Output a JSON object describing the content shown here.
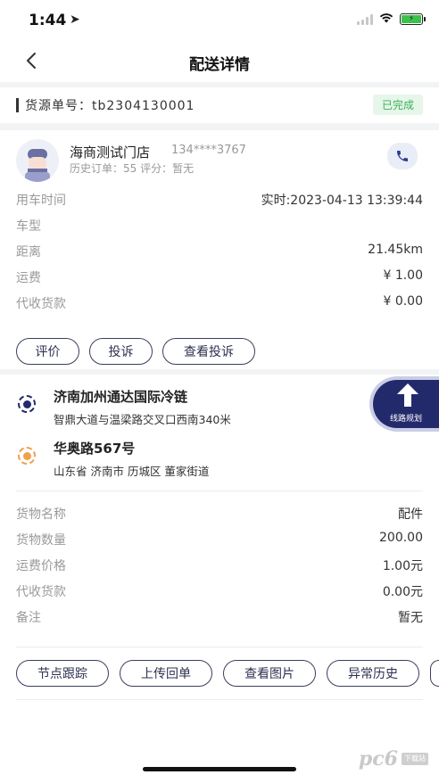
{
  "status_bar": {
    "time": "1:44"
  },
  "header": {
    "title": "配送详情"
  },
  "order": {
    "label": "货源单号：tb2304130001",
    "status": "已完成"
  },
  "shop": {
    "name": "海商测试门店",
    "phone": "134****3767",
    "history": "历史订单：55  评分：暂无",
    "rows": [
      {
        "key": "用车时间",
        "value": "实时:2023-04-13 13:39:44"
      },
      {
        "key": "车型",
        "value": ""
      },
      {
        "key": "距离",
        "value": "21.45km"
      },
      {
        "key": "运费",
        "value": "¥ 1.00"
      },
      {
        "key": "代收货款",
        "value": "¥ 0.00"
      }
    ],
    "actions": [
      "评价",
      "投诉",
      "查看投诉"
    ]
  },
  "route": {
    "start": {
      "title": "济南加州通达国际冷链",
      "address": "智鼎大道与温梁路交叉口西南340米"
    },
    "end": {
      "title": "华奥路567号",
      "address": "山东省 济南市 历城区 董家街道"
    },
    "plan_label": "线路规划"
  },
  "goods": {
    "rows": [
      {
        "key": "货物名称",
        "value": "配件"
      },
      {
        "key": "货物数量",
        "value": "200.00"
      },
      {
        "key": "运费价格",
        "value": "1.00元"
      },
      {
        "key": "代收货款",
        "value": "0.00元"
      },
      {
        "key": "备注",
        "value": "暂无"
      }
    ],
    "actions": [
      "节点跟踪",
      "上传回单",
      "查看图片",
      "异常历史"
    ]
  },
  "watermark": {
    "text": "pc6",
    "badge": "下载站"
  },
  "colors": {
    "accent": "#232a6c",
    "completed_bg": "#e6f6e9",
    "completed_text": "#3bb15a",
    "start_dot": "#232a6c",
    "end_dot": "#f0a04b"
  }
}
